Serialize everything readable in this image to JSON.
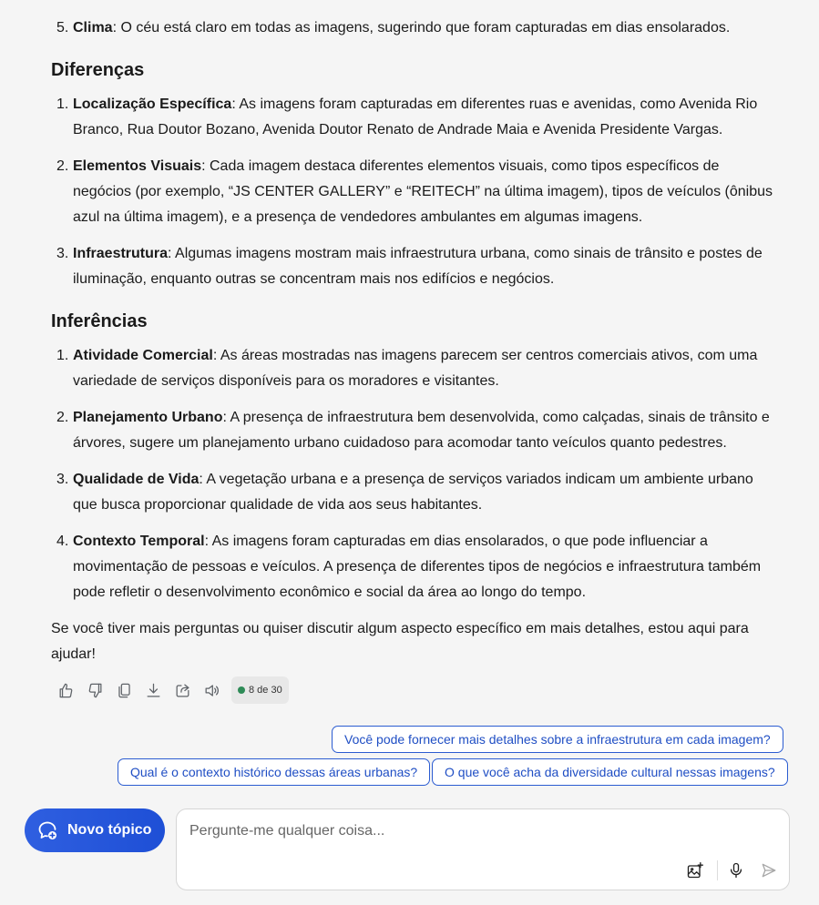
{
  "message": {
    "prev_item": {
      "num": "5.",
      "title": "Clima",
      "text": ": O céu está claro em todas as imagens, sugerindo que foram capturadas em dias ensolarados."
    },
    "section_differences": {
      "heading": "Diferenças",
      "items": [
        {
          "num": "1.",
          "title": "Localização Específica",
          "text": ": As imagens foram capturadas em diferentes ruas e avenidas, como Avenida Rio Branco, Rua Doutor Bozano, Avenida Doutor Renato de Andrade Maia e Avenida Presidente Vargas."
        },
        {
          "num": "2.",
          "title": "Elementos Visuais",
          "text": ": Cada imagem destaca diferentes elementos visuais, como tipos específicos de negócios (por exemplo, “JS CENTER GALLERY” e “REITECH” na última imagem), tipos de veículos (ônibus azul na última imagem), e a presença de vendedores ambulantes em algumas imagens."
        },
        {
          "num": "3.",
          "title": "Infraestrutura",
          "text": ": Algumas imagens mostram mais infraestrutura urbana, como sinais de trânsito e postes de iluminação, enquanto outras se concentram mais nos edifícios e negócios."
        }
      ]
    },
    "section_inferences": {
      "heading": "Inferências",
      "items": [
        {
          "num": "1.",
          "title": "Atividade Comercial",
          "text": ": As áreas mostradas nas imagens parecem ser centros comerciais ativos, com uma variedade de serviços disponíveis para os moradores e visitantes."
        },
        {
          "num": "2.",
          "title": "Planejamento Urbano",
          "text": ": A presença de infraestrutura bem desenvolvida, como calçadas, sinais de trânsito e árvores, sugere um planejamento urbano cuidadoso para acomodar tanto veículos quanto pedestres."
        },
        {
          "num": "3.",
          "title": "Qualidade de Vida",
          "text": ": A vegetação urbana e a presença de serviços variados indicam um ambiente urbano que busca proporcionar qualidade de vida aos seus habitantes."
        },
        {
          "num": "4.",
          "title": "Contexto Temporal",
          "text": ": As imagens foram capturadas em dias ensolarados, o que pode influenciar a movimentação de pessoas e veículos. A presença de diferentes tipos de negócios e infraestrutura também pode refletir o desenvolvimento econômico e social da área ao longo do tempo."
        }
      ]
    },
    "closing": "Se você tiver mais perguntas ou quiser discutir algum aspecto específico em mais detalhes, estou aqui para ajudar!"
  },
  "actions": {
    "icons": [
      "thumbs-up-icon",
      "thumbs-down-icon",
      "copy-icon",
      "download-icon",
      "share-icon",
      "speaker-icon"
    ],
    "counter": "8 de 30",
    "counter_dot_color": "#2e8b57"
  },
  "suggestions": [
    "Você pode fornecer mais detalhes sobre a infraestrutura em cada imagem?",
    "Qual é o contexto histórico dessas áreas urbanas?",
    "O que você acha da diversidade cultural nessas imagens?"
  ],
  "composer": {
    "new_topic_label": "Novo tópico",
    "placeholder": "Pergunte-me qualquer coisa...",
    "icons": [
      "image-add-icon",
      "microphone-icon",
      "send-icon"
    ],
    "accent": "#2f5fe0"
  }
}
